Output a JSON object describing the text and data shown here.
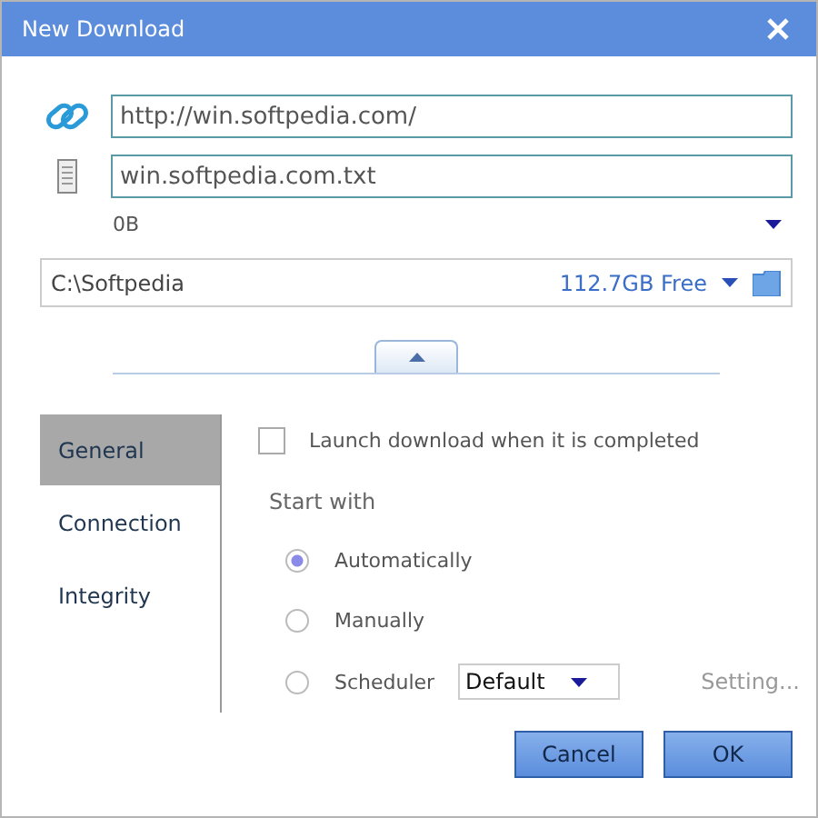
{
  "window": {
    "title": "New Download"
  },
  "url_field": {
    "value": "http://win.softpedia.com/"
  },
  "filename_field": {
    "value": "win.softpedia.com.txt"
  },
  "size": "0B",
  "location": {
    "path": "C:\\Softpedia",
    "free": "112.7GB Free"
  },
  "tabs": [
    {
      "label": "General",
      "selected": true
    },
    {
      "label": "Connection",
      "selected": false
    },
    {
      "label": "Integrity",
      "selected": false
    }
  ],
  "launch_checkbox": {
    "label": "Launch download when it is completed",
    "checked": false
  },
  "start_with": {
    "label": "Start with",
    "options": [
      {
        "label": "Automatically",
        "selected": true
      },
      {
        "label": "Manually",
        "selected": false
      },
      {
        "label": "Scheduler",
        "selected": false,
        "dropdown": "Default",
        "link": "Setting..."
      }
    ]
  },
  "buttons": [
    "Cancel",
    "OK"
  ]
}
